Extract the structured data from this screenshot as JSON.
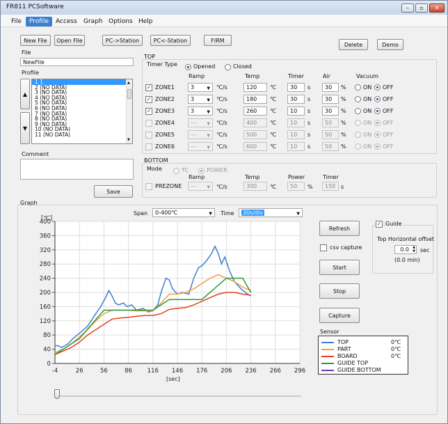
{
  "window": {
    "title": "FR811 PCSoftware"
  },
  "menu": [
    "File",
    "Profile",
    "Access",
    "Graph",
    "Options",
    "Help"
  ],
  "toolbar": {
    "new_file": "New File",
    "open_file": "Open File",
    "pc_to_station": "PC->Station",
    "pc_from_station": "PC<-Station",
    "firm": "FIRM",
    "delete": "Delete",
    "demo": "Demo"
  },
  "file": {
    "label": "File",
    "value": "NewFile"
  },
  "profile": {
    "label": "Profile",
    "items": [
      "1 1",
      "2 (NO DATA)",
      "3 (NO DATA)",
      "4 (NO DATA)",
      "5 (NO DATA)",
      "6 (NO DATA)",
      "7 (NO DATA)",
      "8 (NO DATA)",
      "9 (NO DATA)",
      "10 (NO DATA)",
      "11 (NO DATA)"
    ],
    "selected_index": 0
  },
  "comment": {
    "label": "Comment",
    "value": ""
  },
  "save": "Save",
  "top": {
    "title": "TOP",
    "timer_type_label": "Timer Type",
    "opened": "Opened",
    "closed": "Closed",
    "headers": {
      "ramp": "Ramp",
      "temp": "Temp",
      "timer": "Timer",
      "air": "Air",
      "vacuum": "Vacuum"
    },
    "unit_ramp": "℃/s",
    "unit_temp": "℃",
    "unit_timer": "s",
    "unit_air": "%",
    "on": "ON",
    "off": "OFF",
    "zones": [
      {
        "name": "ZONE1",
        "checked": true,
        "ramp": "3",
        "temp": "120",
        "timer": "30",
        "air": "30",
        "enabled": true
      },
      {
        "name": "ZONE2",
        "checked": true,
        "ramp": "3",
        "temp": "180",
        "timer": "30",
        "air": "30",
        "enabled": true
      },
      {
        "name": "ZONE3",
        "checked": true,
        "ramp": "3",
        "temp": "260",
        "timer": "10",
        "air": "30",
        "enabled": true
      },
      {
        "name": "ZONE4",
        "checked": false,
        "ramp": "---",
        "temp": "400",
        "timer": "10",
        "air": "50",
        "enabled": false
      },
      {
        "name": "ZONE5",
        "checked": false,
        "ramp": "---",
        "temp": "500",
        "timer": "10",
        "air": "50",
        "enabled": false
      },
      {
        "name": "ZONE6",
        "checked": false,
        "ramp": "---",
        "temp": "600",
        "timer": "10",
        "air": "50",
        "enabled": false
      }
    ]
  },
  "bottom": {
    "title": "BOTTOM",
    "mode_label": "Mode",
    "tc": "TC",
    "power": "POWER",
    "ramp_h": "Ramp",
    "temp_h": "Temp",
    "power_h": "Power",
    "timer_h": "Timer",
    "prezone": "PREZONE",
    "ramp": "---",
    "unit_ramp": "℃/s",
    "temp": "300",
    "unit_temp": "℃",
    "power_v": "50",
    "unit_power": "%",
    "timer": "150",
    "unit_timer": "s"
  },
  "graph": {
    "label": "Graph",
    "span_label": "Span",
    "span_value": "0-400℃",
    "time_label": "Time",
    "time_value": "30s/div",
    "y_unit": "[℃]",
    "x_unit": "[sec]",
    "refresh": "Refresh",
    "csv_capture": "csv capture",
    "start": "Start",
    "stop": "Stop",
    "capture": "Capture",
    "guide": "Guide",
    "offset_label": "Top Horizontal offset",
    "offset_value": "0.0",
    "offset_unit": "sec",
    "offset_min": "(0.0 min)",
    "sensor_label": "Sensor",
    "sensors": [
      {
        "name": "TOP",
        "value": "0℃",
        "color": "#3a7fd0"
      },
      {
        "name": "PART",
        "value": "0℃",
        "color": "#f0a040"
      },
      {
        "name": "BOARD",
        "value": "0℃",
        "color": "#e04020"
      },
      {
        "name": "GUIDE TOP",
        "value": "",
        "color": "#2a9a3a"
      },
      {
        "name": "GUIDE BOTTOM",
        "value": "",
        "color": "#7030b0"
      }
    ]
  },
  "chart_data": {
    "type": "line",
    "xlim": [
      -4,
      296
    ],
    "ylim": [
      0,
      400
    ],
    "x_ticks": [
      -4,
      26,
      56,
      86,
      116,
      146,
      176,
      206,
      236,
      266,
      296
    ],
    "y_ticks": [
      0,
      40,
      80,
      120,
      160,
      200,
      240,
      280,
      320,
      360,
      400
    ],
    "xlabel": "[sec]",
    "ylabel": "[℃]",
    "grid": true,
    "series": [
      {
        "name": "TOP",
        "color": "#3a7fd0",
        "points": [
          [
            -4,
            50
          ],
          [
            0,
            50
          ],
          [
            4,
            45
          ],
          [
            8,
            50
          ],
          [
            12,
            55
          ],
          [
            18,
            70
          ],
          [
            26,
            85
          ],
          [
            36,
            105
          ],
          [
            46,
            140
          ],
          [
            52,
            160
          ],
          [
            58,
            185
          ],
          [
            62,
            205
          ],
          [
            66,
            190
          ],
          [
            70,
            170
          ],
          [
            74,
            165
          ],
          [
            80,
            170
          ],
          [
            84,
            160
          ],
          [
            90,
            165
          ],
          [
            96,
            150
          ],
          [
            104,
            155
          ],
          [
            110,
            145
          ],
          [
            116,
            148
          ],
          [
            122,
            165
          ],
          [
            126,
            200
          ],
          [
            132,
            240
          ],
          [
            136,
            235
          ],
          [
            140,
            210
          ],
          [
            146,
            195
          ],
          [
            152,
            200
          ],
          [
            160,
            195
          ],
          [
            166,
            240
          ],
          [
            172,
            270
          ],
          [
            176,
            275
          ],
          [
            182,
            290
          ],
          [
            188,
            310
          ],
          [
            192,
            330
          ],
          [
            196,
            310
          ],
          [
            200,
            280
          ],
          [
            204,
            300
          ],
          [
            210,
            260
          ],
          [
            216,
            230
          ],
          [
            224,
            210
          ],
          [
            232,
            195
          ],
          [
            236,
            190
          ]
        ]
      },
      {
        "name": "PART",
        "color": "#f0a040",
        "points": [
          [
            -4,
            30
          ],
          [
            6,
            40
          ],
          [
            16,
            55
          ],
          [
            26,
            75
          ],
          [
            36,
            95
          ],
          [
            46,
            120
          ],
          [
            56,
            140
          ],
          [
            66,
            150
          ],
          [
            76,
            150
          ],
          [
            86,
            150
          ],
          [
            96,
            148
          ],
          [
            106,
            148
          ],
          [
            116,
            148
          ],
          [
            126,
            170
          ],
          [
            136,
            195
          ],
          [
            146,
            195
          ],
          [
            156,
            200
          ],
          [
            166,
            210
          ],
          [
            176,
            225
          ],
          [
            186,
            240
          ],
          [
            196,
            250
          ],
          [
            206,
            240
          ],
          [
            216,
            230
          ],
          [
            226,
            215
          ],
          [
            236,
            205
          ]
        ]
      },
      {
        "name": "BOARD",
        "color": "#e04020",
        "points": [
          [
            -4,
            25
          ],
          [
            6,
            35
          ],
          [
            16,
            45
          ],
          [
            26,
            60
          ],
          [
            36,
            80
          ],
          [
            46,
            95
          ],
          [
            56,
            110
          ],
          [
            66,
            125
          ],
          [
            76,
            128
          ],
          [
            86,
            130
          ],
          [
            96,
            133
          ],
          [
            106,
            135
          ],
          [
            116,
            135
          ],
          [
            126,
            140
          ],
          [
            136,
            152
          ],
          [
            146,
            155
          ],
          [
            156,
            157
          ],
          [
            166,
            165
          ],
          [
            176,
            175
          ],
          [
            186,
            185
          ],
          [
            196,
            195
          ],
          [
            206,
            200
          ],
          [
            216,
            200
          ],
          [
            226,
            195
          ],
          [
            236,
            192
          ]
        ]
      },
      {
        "name": "GUIDE TOP",
        "color": "#2a9a3a",
        "points": [
          [
            -4,
            25
          ],
          [
            26,
            70
          ],
          [
            56,
            150
          ],
          [
            116,
            150
          ],
          [
            136,
            180
          ],
          [
            176,
            180
          ],
          [
            206,
            240
          ],
          [
            226,
            240
          ],
          [
            236,
            200
          ]
        ]
      }
    ]
  }
}
